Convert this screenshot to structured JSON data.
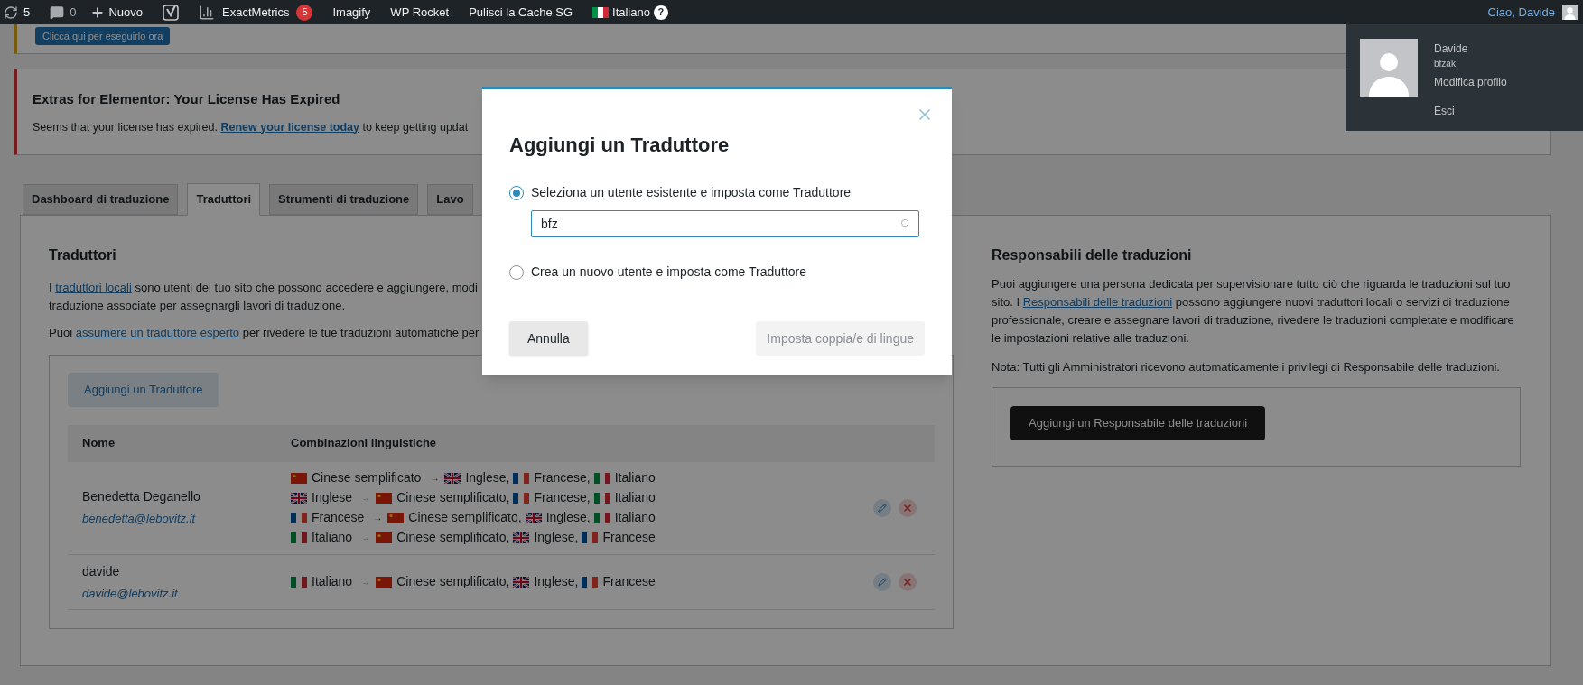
{
  "admin_bar": {
    "updates": "5",
    "comments": "0",
    "new": "Nuovo",
    "items": [
      {
        "kind": "yoast"
      },
      {
        "kind": "stats",
        "label": "ExactMetrics",
        "badge": "5"
      },
      {
        "kind": "text",
        "label": "Imagify"
      },
      {
        "kind": "text",
        "label": "WP Rocket"
      },
      {
        "kind": "text",
        "label": "Pulisci la Cache SG"
      },
      {
        "kind": "language",
        "label": "Italiano",
        "help": "?"
      }
    ],
    "greeting": "Ciao, Davide"
  },
  "user_menu": {
    "name": "Davide",
    "username": "bfzak",
    "edit_profile": "Modifica profilo",
    "logout": "Esci"
  },
  "update_notice": {
    "button": "Clicca qui per eseguirlo ora"
  },
  "license_notice": {
    "title": "Extras for Elementor: Your License Has Expired",
    "text_before": "Seems that your license has expired.",
    "link": "Renew your license today",
    "text_after": "to keep getting updat"
  },
  "tabs": [
    {
      "label": "Dashboard di traduzione",
      "selected": false
    },
    {
      "label": "Traduttori",
      "selected": true
    },
    {
      "label": "Strumenti di traduzione",
      "selected": false
    },
    {
      "label": "Lavo",
      "selected": false
    }
  ],
  "translators": {
    "title": "Traduttori",
    "para1_before": "I",
    "para1_link": "traduttori locali",
    "para1_after": "sono utenti del tuo sito che possono accedere e aggiungere, modi",
    "para1_line2": "traduzione associate per assegnargli lavori di traduzione.",
    "para2_before": "Puoi",
    "para2_link": "assumere un traduttore esperto",
    "para2_after": "per rivedere le tue traduzioni automatiche per",
    "add_button": "Aggiungi un Traduttore",
    "columns": [
      "Nome",
      "Combinazioni linguistiche"
    ],
    "rows": [
      {
        "name": "Benedetta Deganello",
        "email": "benedetta@lebovitz.it",
        "pairs": [
          {
            "from": {
              "kind": "cn",
              "name": "Cinese semplificato"
            },
            "arrow": "→",
            "to": [
              {
                "kind": "gb",
                "name": "Inglese,"
              },
              {
                "kind": "fr",
                "name": "Francese,"
              },
              {
                "kind": "it",
                "name": "Italiano"
              }
            ]
          },
          {
            "from": {
              "kind": "gb",
              "name": "Inglese"
            },
            "arrow": "→",
            "to": [
              {
                "kind": "cn",
                "name": "Cinese semplificato,"
              },
              {
                "kind": "fr",
                "name": "Francese,"
              },
              {
                "kind": "it",
                "name": "Italiano"
              }
            ]
          },
          {
            "from": {
              "kind": "fr",
              "name": "Francese"
            },
            "arrow": "→",
            "to": [
              {
                "kind": "cn",
                "name": "Cinese semplificato,"
              },
              {
                "kind": "gb",
                "name": "Inglese,"
              },
              {
                "kind": "it",
                "name": "Italiano"
              }
            ]
          },
          {
            "from": {
              "kind": "it",
              "name": "Italiano"
            },
            "arrow": "→",
            "to": [
              {
                "kind": "cn",
                "name": "Cinese semplificato,"
              },
              {
                "kind": "gb",
                "name": "Inglese,"
              },
              {
                "kind": "fr",
                "name": "Francese"
              }
            ]
          }
        ]
      },
      {
        "name": "davide",
        "email": "davide@lebovitz.it",
        "pairs": [
          {
            "from": {
              "kind": "it",
              "name": "Italiano"
            },
            "arrow": "→",
            "to": [
              {
                "kind": "cn",
                "name": "Cinese semplificato,"
              },
              {
                "kind": "gb",
                "name": "Inglese,"
              },
              {
                "kind": "fr",
                "name": "Francese"
              }
            ]
          }
        ]
      }
    ]
  },
  "managers": {
    "title": "Responsabili delle traduzioni",
    "para_before": "Puoi aggiungere una persona dedicata per supervisionare tutto ciò che riguarda le traduzioni sul tuo sito. I",
    "para_link": "Responsabili delle traduzioni",
    "para_after": "possono aggiungere nuovi traduttori locali o servizi di traduzione professionale, creare e assegnare lavori di traduzione, rivedere le traduzioni completate e modificare le impostazioni relative alle traduzioni.",
    "note": "Nota: Tutti gli Amministratori ricevono automaticamente i privilegi di Responsabile delle traduzioni.",
    "add_button": "Aggiungi un Responsabile delle traduzioni"
  },
  "modal": {
    "title": "Aggiungi un Traduttore",
    "options": [
      {
        "label": "Seleziona un utente esistente e imposta come Traduttore",
        "selected": true
      },
      {
        "label": "Crea un nuovo utente e imposta come Traduttore",
        "selected": false
      }
    ],
    "search_value": "bfz",
    "cancel": "Annulla",
    "confirm": {
      "label": "Imposta coppia/e di lingue",
      "disabled": true
    }
  }
}
